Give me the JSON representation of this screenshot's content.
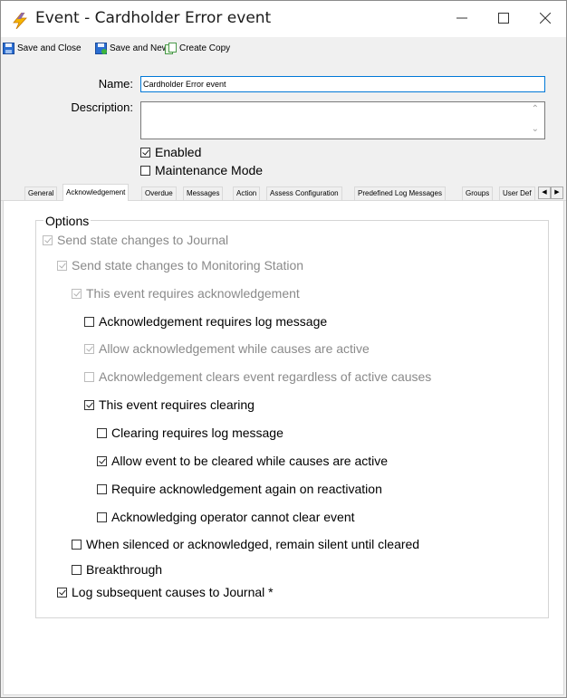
{
  "window": {
    "title": "Event  -  Cardholder Error event",
    "icon": "lightning-bolt-icon"
  },
  "toolbar": {
    "save_close": "Save and Close",
    "save_new": "Save and New",
    "create_copy": "Create Copy"
  },
  "form": {
    "name_label": "Name:",
    "name_value": "Cardholder Error event",
    "description_label": "Description:",
    "description_value": "",
    "enabled_label": "Enabled",
    "maintenance_label": "Maintenance Mode"
  },
  "tabs": [
    "General",
    "Acknowledgement",
    "Overdue",
    "Messages",
    "Action",
    "Assess Configuration",
    "Predefined Log Messages",
    "Groups",
    "User Def"
  ],
  "options": {
    "title": "Options",
    "items": [
      {
        "label": "Send state changes to Journal",
        "checked": true,
        "disabled": true
      },
      {
        "label": "Send state changes to Monitoring Station",
        "checked": true,
        "disabled": true
      },
      {
        "label": "This event requires acknowledgement",
        "checked": true,
        "disabled": true
      },
      {
        "label": "Acknowledgement requires log message",
        "checked": false,
        "disabled": false
      },
      {
        "label": "Allow acknowledgement while causes are active",
        "checked": true,
        "disabled": true
      },
      {
        "label": "Acknowledgement clears event regardless of active causes",
        "checked": false,
        "disabled": true
      },
      {
        "label": "This event requires clearing",
        "checked": true,
        "disabled": false
      },
      {
        "label": "Clearing requires log message",
        "checked": false,
        "disabled": false
      },
      {
        "label": "Allow event to be cleared while causes are active",
        "checked": true,
        "disabled": false
      },
      {
        "label": "Require acknowledgement again on reactivation",
        "checked": false,
        "disabled": false
      },
      {
        "label": "Acknowledging operator cannot clear event",
        "checked": false,
        "disabled": false
      },
      {
        "label": "When silenced or acknowledged, remain silent until cleared",
        "checked": false,
        "disabled": false
      },
      {
        "label": "Breakthrough",
        "checked": false,
        "disabled": false
      },
      {
        "label": "Log subsequent causes to Journal *",
        "checked": true,
        "disabled": false
      }
    ]
  }
}
